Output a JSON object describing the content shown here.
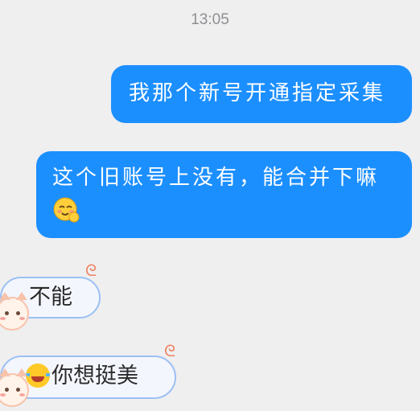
{
  "chat": {
    "timestamp": "13:05",
    "messages": [
      {
        "from": "me",
        "text": "我那个新号开通指定采集"
      },
      {
        "from": "me",
        "text": "这个旧账号上没有，能合并下嘛",
        "emoji": "shy-smile-emoji"
      },
      {
        "from": "other",
        "text": "不能",
        "avatar": "cat-face-icon"
      },
      {
        "from": "other",
        "text": "你想挺美",
        "emoji": "laughing-tears-emoji",
        "avatar": "cat-face-icon"
      }
    ]
  },
  "colors": {
    "background": "#efeff0",
    "outgoing_bubble": "#1c8fff",
    "incoming_bubble_border": "#9cc0f4",
    "timestamp_text": "#8f8f92"
  }
}
